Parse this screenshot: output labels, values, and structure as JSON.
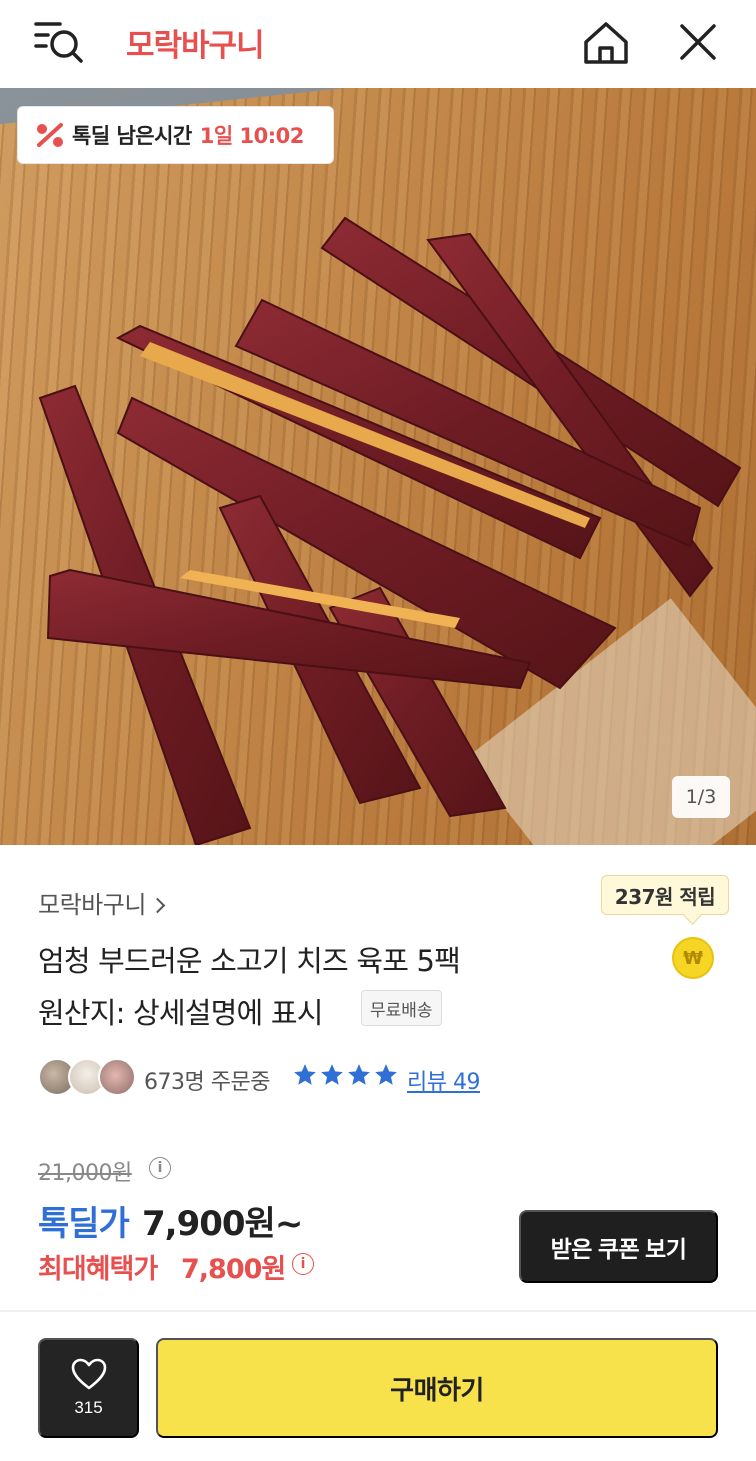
{
  "header": {
    "brand": "모락바구니",
    "icons": [
      "search-menu-icon",
      "home-icon",
      "close-icon"
    ]
  },
  "hero": {
    "deal_label": "톡딜 남은시간",
    "deal_time": "1일 10:02",
    "page_indicator": "1/3"
  },
  "product": {
    "seller": "모락바구니",
    "points": "237원 적립",
    "coin_symbol": "₩",
    "title": "엄청 부드러운 소고기 치즈 육포 5팩",
    "origin": "원산지: 상세설명에 표시",
    "shipping_badge": "무료배송",
    "order_count": "673명 주문중",
    "rating_stars": 4,
    "review_link": "리뷰 49"
  },
  "price": {
    "original": "21,000원",
    "deal_label": "톡딜가",
    "deal_price": "7,900원~",
    "max_benefit_label": "최대혜택가",
    "max_benefit_price": "7,800원",
    "info_symbol": "i"
  },
  "actions": {
    "coupon_button": "받은 쿠폰 보기",
    "like_count": "315",
    "buy_button": "구매하기"
  },
  "colors": {
    "brand_red": "#e8504f",
    "deal_blue": "#2f6fd6",
    "buy_yellow": "#f7e24c",
    "dark_button": "#1f1f1f"
  }
}
